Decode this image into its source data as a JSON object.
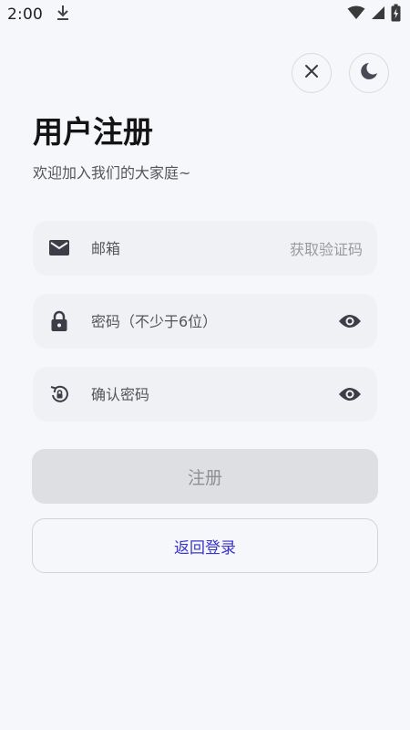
{
  "status_bar": {
    "time": "2:00",
    "icons": [
      "download-icon",
      "wifi-icon",
      "signal-icon",
      "battery-charging-icon"
    ]
  },
  "top_actions": {
    "close_icon": "close-icon",
    "theme_icon": "moon-icon"
  },
  "header": {
    "title": "用户注册",
    "subtitle": "欢迎加入我们的大家庭~"
  },
  "form": {
    "email": {
      "placeholder": "邮箱",
      "value": "",
      "icon": "mail-icon",
      "action_label": "获取验证码"
    },
    "password": {
      "placeholder": "密码（不少于6位）",
      "value": "",
      "icon": "lock-icon",
      "toggle_icon": "eye-icon"
    },
    "confirm": {
      "placeholder": "确认密码",
      "value": "",
      "icon": "lock-reset-icon",
      "toggle_icon": "eye-icon"
    }
  },
  "buttons": {
    "register_label": "注册",
    "back_label": "返回登录"
  },
  "colors": {
    "background": "#f6f7fb",
    "field_bg": "#f0f1f5",
    "disabled_button": "#dedfe3",
    "link_accent": "#3b36c9"
  }
}
